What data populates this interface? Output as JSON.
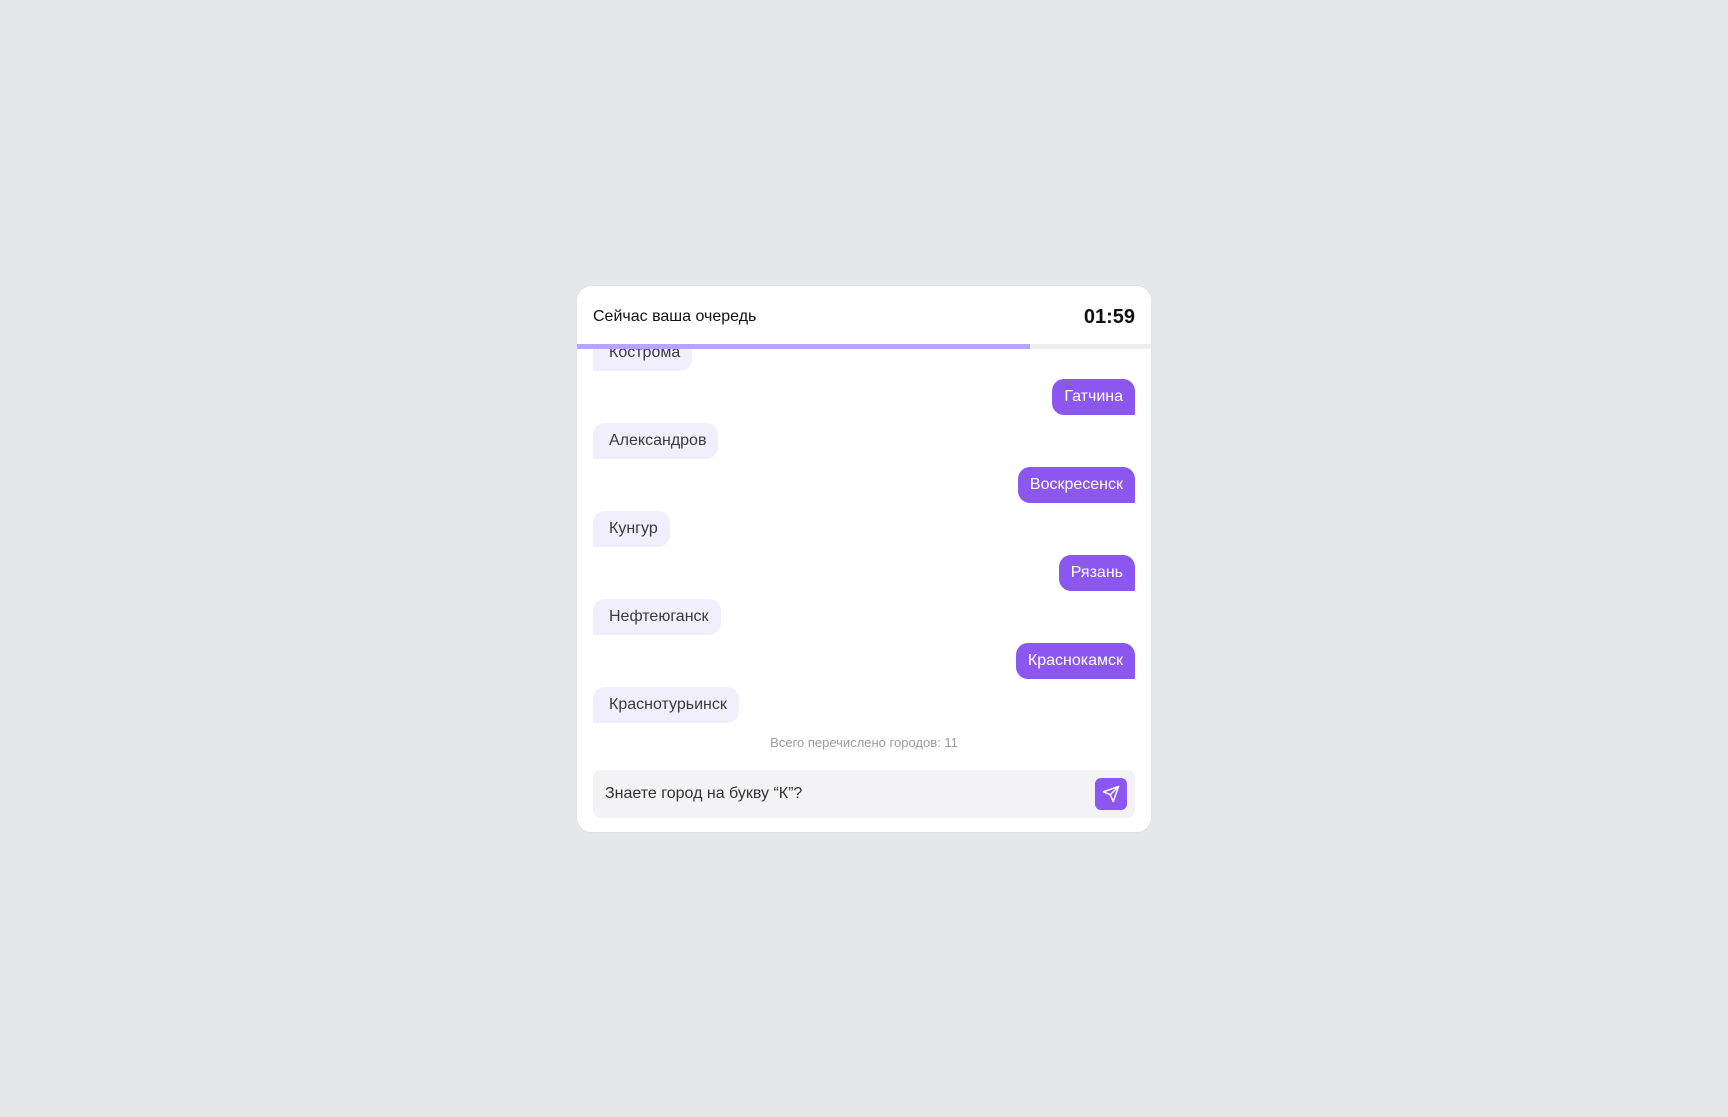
{
  "header": {
    "title": "Сейчас ваша очередь",
    "timer": "01:59",
    "progress": 0.79
  },
  "messages": [
    {
      "from": "them",
      "text": "Кострома"
    },
    {
      "from": "me",
      "text": "Гатчина"
    },
    {
      "from": "them",
      "text": "Александров"
    },
    {
      "from": "me",
      "text": "Воскресенск"
    },
    {
      "from": "them",
      "text": "Кунгур"
    },
    {
      "from": "me",
      "text": "Рязань"
    },
    {
      "from": "them",
      "text": "Нефтеюганск"
    },
    {
      "from": "me",
      "text": "Краснокамск"
    },
    {
      "from": "them",
      "text": "Краснотурьинск"
    }
  ],
  "footer": {
    "total_text": "Всего перечислено городов: 11"
  },
  "input": {
    "placeholder": "Знаете город на букву “К”?",
    "value": ""
  },
  "colors": {
    "accent": "#8b57f0",
    "progress": "#b7a5f7",
    "their_bubble": "#f1effb",
    "background": "#e6e7ea"
  },
  "icons": {
    "send": "send-icon"
  }
}
